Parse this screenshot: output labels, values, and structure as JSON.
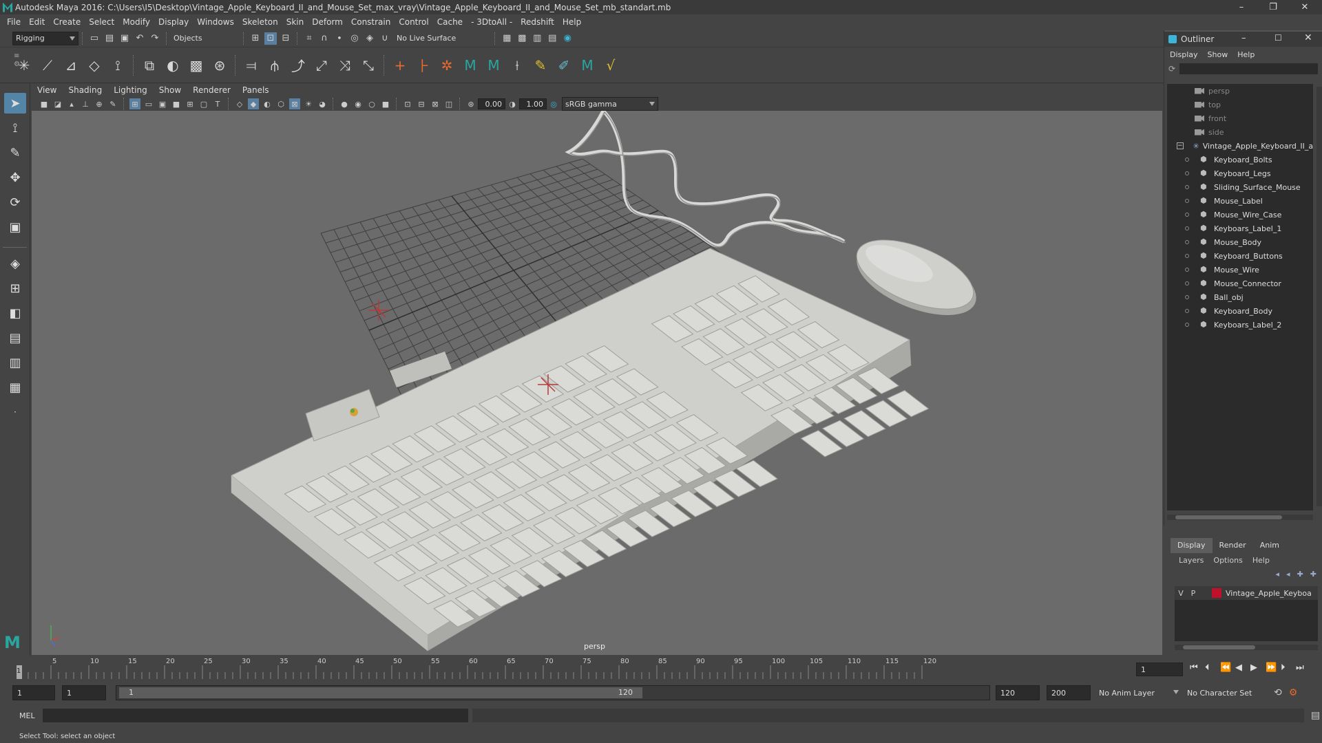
{
  "window": {
    "title": "Autodesk Maya 2016: C:\\Users\\I5\\Desktop\\Vintage_Apple_Keyboard_II_and_Mouse_Set_max_vray\\Vintage_Apple_Keyboard_II_and_Mouse_Set_mb_standart.mb",
    "controls": [
      "–",
      "❐",
      "✕"
    ]
  },
  "menubar": [
    "File",
    "Edit",
    "Create",
    "Select",
    "Modify",
    "Display",
    "Windows",
    "Skeleton",
    "Skin",
    "Deform",
    "Constrain",
    "Control",
    "Cache",
    "- 3DtoAll -",
    "Redshift",
    "Help"
  ],
  "statusline": {
    "mode": "Rigging",
    "objects": "Objects",
    "live_surface": "No Live Surface"
  },
  "viewport": {
    "menu": [
      "View",
      "Shading",
      "Lighting",
      "Show",
      "Renderer",
      "Panels"
    ],
    "field_a": "0.00",
    "field_b": "1.00",
    "color_space": "sRGB gamma",
    "camera_label": "persp"
  },
  "outliner": {
    "title": "Outliner",
    "menu": [
      "Display",
      "Show",
      "Help"
    ],
    "cameras": [
      "persp",
      "top",
      "front",
      "side"
    ],
    "group": "Vintage_Apple_Keyboard_II_ar",
    "children": [
      "Keyboard_Bolts",
      "Keyboard_Legs",
      "Sliding_Surface_Mouse",
      "Mouse_Label",
      "Mouse_Wire_Case",
      "Keyboars_Label_1",
      "Mouse_Body",
      "Keyboard_Buttons",
      "Mouse_Wire",
      "Mouse_Connector",
      "Ball_obj",
      "Keyboard_Body",
      "Keyboars_Label_2"
    ]
  },
  "layers": {
    "tabs": [
      "Display",
      "Render",
      "Anim"
    ],
    "menu": [
      "Layers",
      "Options",
      "Help"
    ],
    "row": {
      "v": "V",
      "p": "P",
      "name": "Vintage_Apple_Keyboa"
    },
    "layer_color": "#c0102a"
  },
  "timeline": {
    "ticks": [
      "5",
      "10",
      "15",
      "20",
      "25",
      "30",
      "35",
      "40",
      "45",
      "50",
      "55",
      "60",
      "65",
      "70",
      "75",
      "80",
      "85",
      "90",
      "95",
      "100",
      "105",
      "110",
      "115",
      "120"
    ],
    "start_marker": "1",
    "current_frame": "1"
  },
  "range": {
    "start": "1",
    "inner_start": "1",
    "slider_start": "1",
    "slider_end": "120",
    "end": "120",
    "max": "200",
    "anim_layer": "No Anim Layer",
    "character_set": "No Character Set"
  },
  "cmd": {
    "label": "MEL"
  },
  "help": {
    "text": "Select Tool: select an object"
  },
  "colors": {
    "accent": "#5285a6",
    "viewport_bg": "#6b6b6b"
  }
}
